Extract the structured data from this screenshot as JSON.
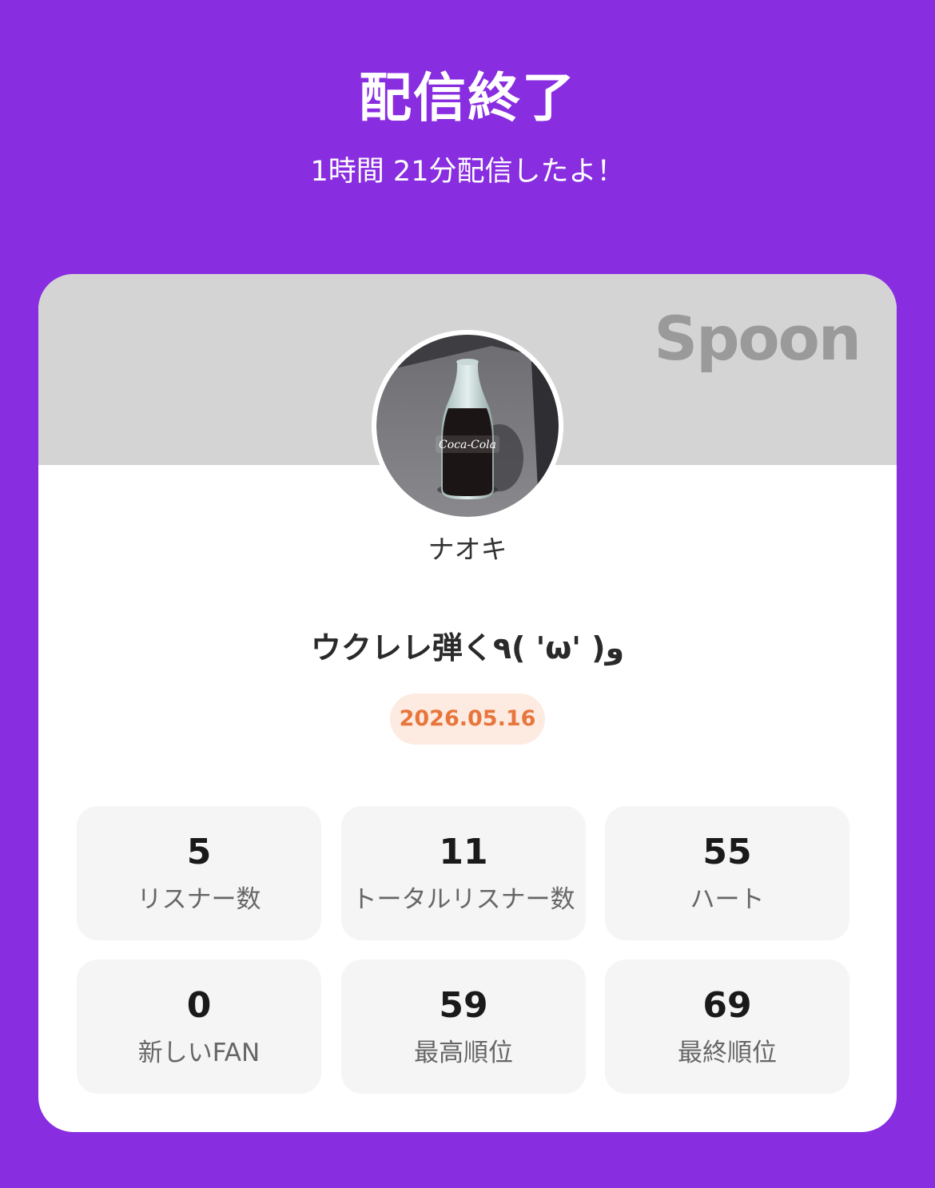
{
  "header": {
    "title": "配信終了",
    "subtitle": "1時間 21分配信したよ！"
  },
  "card": {
    "brand": "Spoon",
    "avatar_icon": "profile-photo-cola-bottle",
    "username": "ナオキ",
    "live_title": "ウクレレ弾く٩( 'ω' )و",
    "date": "2026.05.16"
  },
  "stats": [
    {
      "value": "5",
      "label": "リスナー数"
    },
    {
      "value": "11",
      "label": "トータルリスナー数"
    },
    {
      "value": "55",
      "label": "ハート"
    },
    {
      "value": "0",
      "label": "新しいFAN"
    },
    {
      "value": "59",
      "label": "最高順位"
    },
    {
      "value": "69",
      "label": "最終順位"
    }
  ],
  "colors": {
    "background": "#882de0",
    "banner": "#d4d4d4",
    "date_text": "#e8763c",
    "date_bg": "#fdebe2"
  }
}
